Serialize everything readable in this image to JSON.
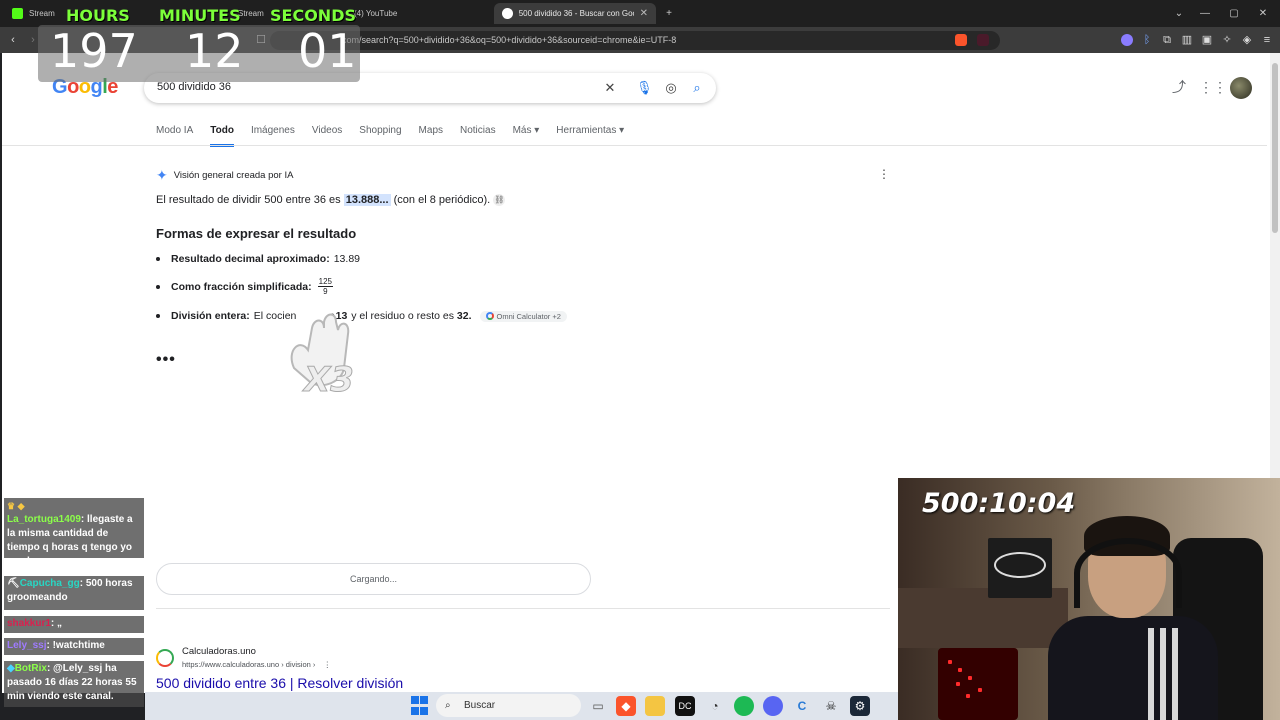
{
  "browser": {
    "tabs": [
      {
        "label": "Stream",
        "icon": "kick-icon",
        "color": "#53fc18"
      },
      {
        "label": "Stream",
        "icon": "stream-icon",
        "color": "#777777"
      },
      {
        "label": "(4) YouTube",
        "icon": "youtube-icon",
        "color": "#ff0000"
      },
      {
        "label": "500 dividido 36 - Buscar con Goo",
        "icon": "google-icon",
        "color": "#ffffff"
      }
    ],
    "url": "com/search?q=500+dividido+36&oq=500+dividido+36&sourceid=chrome&ie=UTF-8"
  },
  "timer": {
    "hours_label": "HOURS",
    "minutes_label": "MINUTES",
    "seconds_label": "SECONDS",
    "hours": "197",
    "minutes": "12",
    "seconds": "01"
  },
  "google": {
    "logo": "Google",
    "query": "500 dividido 36",
    "nav": [
      "Modo IA",
      "Todo",
      "Imágenes",
      "Videos",
      "Shopping",
      "Maps",
      "Noticias",
      "Más",
      "Herramientas"
    ],
    "active_nav": "Todo",
    "ai_overview": {
      "heading": "Visión general creada por IA",
      "intro_before": "El resultado de dividir 500 entre 36 es ",
      "intro_highlight": "13.888...",
      "intro_after": " (con el 8 periódico).",
      "subheading": "Formas de expresar el resultado",
      "bullets": [
        {
          "label": "Resultado decimal aproximado:",
          "text": "13.89"
        },
        {
          "label": "Como fracción simplificada:",
          "numerator": "125",
          "denominator": "9"
        },
        {
          "label": "División entera:",
          "text_before": "El cocien",
          "text_mid": "s ",
          "quotient": "13",
          "text_after": " y el residuo o resto es ",
          "remainder": "32.",
          "source": "Omni Calculator +2"
        }
      ],
      "more": "•••"
    },
    "loading": "Cargando...",
    "result": {
      "site": "Calculadoras.uno",
      "url": "https://www.calculadoras.uno › division ›",
      "title": "500 dividido entre 36 | Resolver división"
    }
  },
  "emote": {
    "text": "X3"
  },
  "chat": [
    {
      "user": "La_tortuga1409",
      "text": ": llegaste a la misma cantidad de tiempo q horas q tengo yo en el cs",
      "color": "#8cff4a"
    },
    {
      "user": "Capucha_gg",
      "text": ": 500 horas groomeando",
      "color": "#28d7c4"
    },
    {
      "user": "shakkur1",
      "text": ": „",
      "color": "#d9204f"
    },
    {
      "user": "Lely_ssj",
      "text": ": !watchtime",
      "color": "#9f7bff"
    },
    {
      "user": "BotRix",
      "text": ": @Lely_ssj ha pasado 16 días 22 horas 55 min viendo este canal.",
      "color": "#8cff4a"
    }
  ],
  "webcam": {
    "timer": "500:10:04"
  },
  "taskbar": {
    "search_placeholder": "Buscar"
  }
}
